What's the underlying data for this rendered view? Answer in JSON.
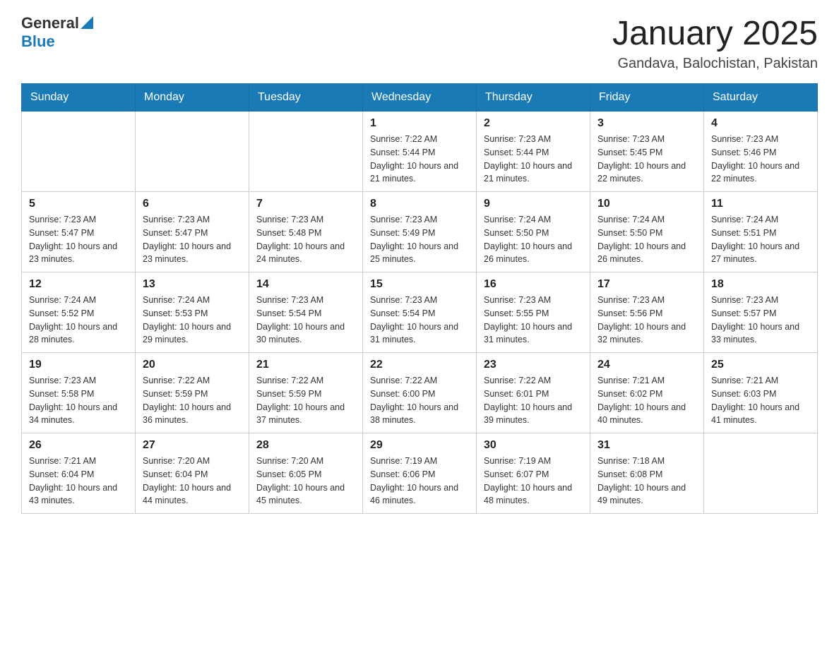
{
  "header": {
    "logo_general": "General",
    "logo_blue": "Blue",
    "title": "January 2025",
    "location": "Gandava, Balochistan, Pakistan"
  },
  "weekdays": [
    "Sunday",
    "Monday",
    "Tuesday",
    "Wednesday",
    "Thursday",
    "Friday",
    "Saturday"
  ],
  "weeks": [
    [
      {
        "day": "",
        "info": ""
      },
      {
        "day": "",
        "info": ""
      },
      {
        "day": "",
        "info": ""
      },
      {
        "day": "1",
        "info": "Sunrise: 7:22 AM\nSunset: 5:44 PM\nDaylight: 10 hours and 21 minutes."
      },
      {
        "day": "2",
        "info": "Sunrise: 7:23 AM\nSunset: 5:44 PM\nDaylight: 10 hours and 21 minutes."
      },
      {
        "day": "3",
        "info": "Sunrise: 7:23 AM\nSunset: 5:45 PM\nDaylight: 10 hours and 22 minutes."
      },
      {
        "day": "4",
        "info": "Sunrise: 7:23 AM\nSunset: 5:46 PM\nDaylight: 10 hours and 22 minutes."
      }
    ],
    [
      {
        "day": "5",
        "info": "Sunrise: 7:23 AM\nSunset: 5:47 PM\nDaylight: 10 hours and 23 minutes."
      },
      {
        "day": "6",
        "info": "Sunrise: 7:23 AM\nSunset: 5:47 PM\nDaylight: 10 hours and 23 minutes."
      },
      {
        "day": "7",
        "info": "Sunrise: 7:23 AM\nSunset: 5:48 PM\nDaylight: 10 hours and 24 minutes."
      },
      {
        "day": "8",
        "info": "Sunrise: 7:23 AM\nSunset: 5:49 PM\nDaylight: 10 hours and 25 minutes."
      },
      {
        "day": "9",
        "info": "Sunrise: 7:24 AM\nSunset: 5:50 PM\nDaylight: 10 hours and 26 minutes."
      },
      {
        "day": "10",
        "info": "Sunrise: 7:24 AM\nSunset: 5:50 PM\nDaylight: 10 hours and 26 minutes."
      },
      {
        "day": "11",
        "info": "Sunrise: 7:24 AM\nSunset: 5:51 PM\nDaylight: 10 hours and 27 minutes."
      }
    ],
    [
      {
        "day": "12",
        "info": "Sunrise: 7:24 AM\nSunset: 5:52 PM\nDaylight: 10 hours and 28 minutes."
      },
      {
        "day": "13",
        "info": "Sunrise: 7:24 AM\nSunset: 5:53 PM\nDaylight: 10 hours and 29 minutes."
      },
      {
        "day": "14",
        "info": "Sunrise: 7:23 AM\nSunset: 5:54 PM\nDaylight: 10 hours and 30 minutes."
      },
      {
        "day": "15",
        "info": "Sunrise: 7:23 AM\nSunset: 5:54 PM\nDaylight: 10 hours and 31 minutes."
      },
      {
        "day": "16",
        "info": "Sunrise: 7:23 AM\nSunset: 5:55 PM\nDaylight: 10 hours and 31 minutes."
      },
      {
        "day": "17",
        "info": "Sunrise: 7:23 AM\nSunset: 5:56 PM\nDaylight: 10 hours and 32 minutes."
      },
      {
        "day": "18",
        "info": "Sunrise: 7:23 AM\nSunset: 5:57 PM\nDaylight: 10 hours and 33 minutes."
      }
    ],
    [
      {
        "day": "19",
        "info": "Sunrise: 7:23 AM\nSunset: 5:58 PM\nDaylight: 10 hours and 34 minutes."
      },
      {
        "day": "20",
        "info": "Sunrise: 7:22 AM\nSunset: 5:59 PM\nDaylight: 10 hours and 36 minutes."
      },
      {
        "day": "21",
        "info": "Sunrise: 7:22 AM\nSunset: 5:59 PM\nDaylight: 10 hours and 37 minutes."
      },
      {
        "day": "22",
        "info": "Sunrise: 7:22 AM\nSunset: 6:00 PM\nDaylight: 10 hours and 38 minutes."
      },
      {
        "day": "23",
        "info": "Sunrise: 7:22 AM\nSunset: 6:01 PM\nDaylight: 10 hours and 39 minutes."
      },
      {
        "day": "24",
        "info": "Sunrise: 7:21 AM\nSunset: 6:02 PM\nDaylight: 10 hours and 40 minutes."
      },
      {
        "day": "25",
        "info": "Sunrise: 7:21 AM\nSunset: 6:03 PM\nDaylight: 10 hours and 41 minutes."
      }
    ],
    [
      {
        "day": "26",
        "info": "Sunrise: 7:21 AM\nSunset: 6:04 PM\nDaylight: 10 hours and 43 minutes."
      },
      {
        "day": "27",
        "info": "Sunrise: 7:20 AM\nSunset: 6:04 PM\nDaylight: 10 hours and 44 minutes."
      },
      {
        "day": "28",
        "info": "Sunrise: 7:20 AM\nSunset: 6:05 PM\nDaylight: 10 hours and 45 minutes."
      },
      {
        "day": "29",
        "info": "Sunrise: 7:19 AM\nSunset: 6:06 PM\nDaylight: 10 hours and 46 minutes."
      },
      {
        "day": "30",
        "info": "Sunrise: 7:19 AM\nSunset: 6:07 PM\nDaylight: 10 hours and 48 minutes."
      },
      {
        "day": "31",
        "info": "Sunrise: 7:18 AM\nSunset: 6:08 PM\nDaylight: 10 hours and 49 minutes."
      },
      {
        "day": "",
        "info": ""
      }
    ]
  ]
}
